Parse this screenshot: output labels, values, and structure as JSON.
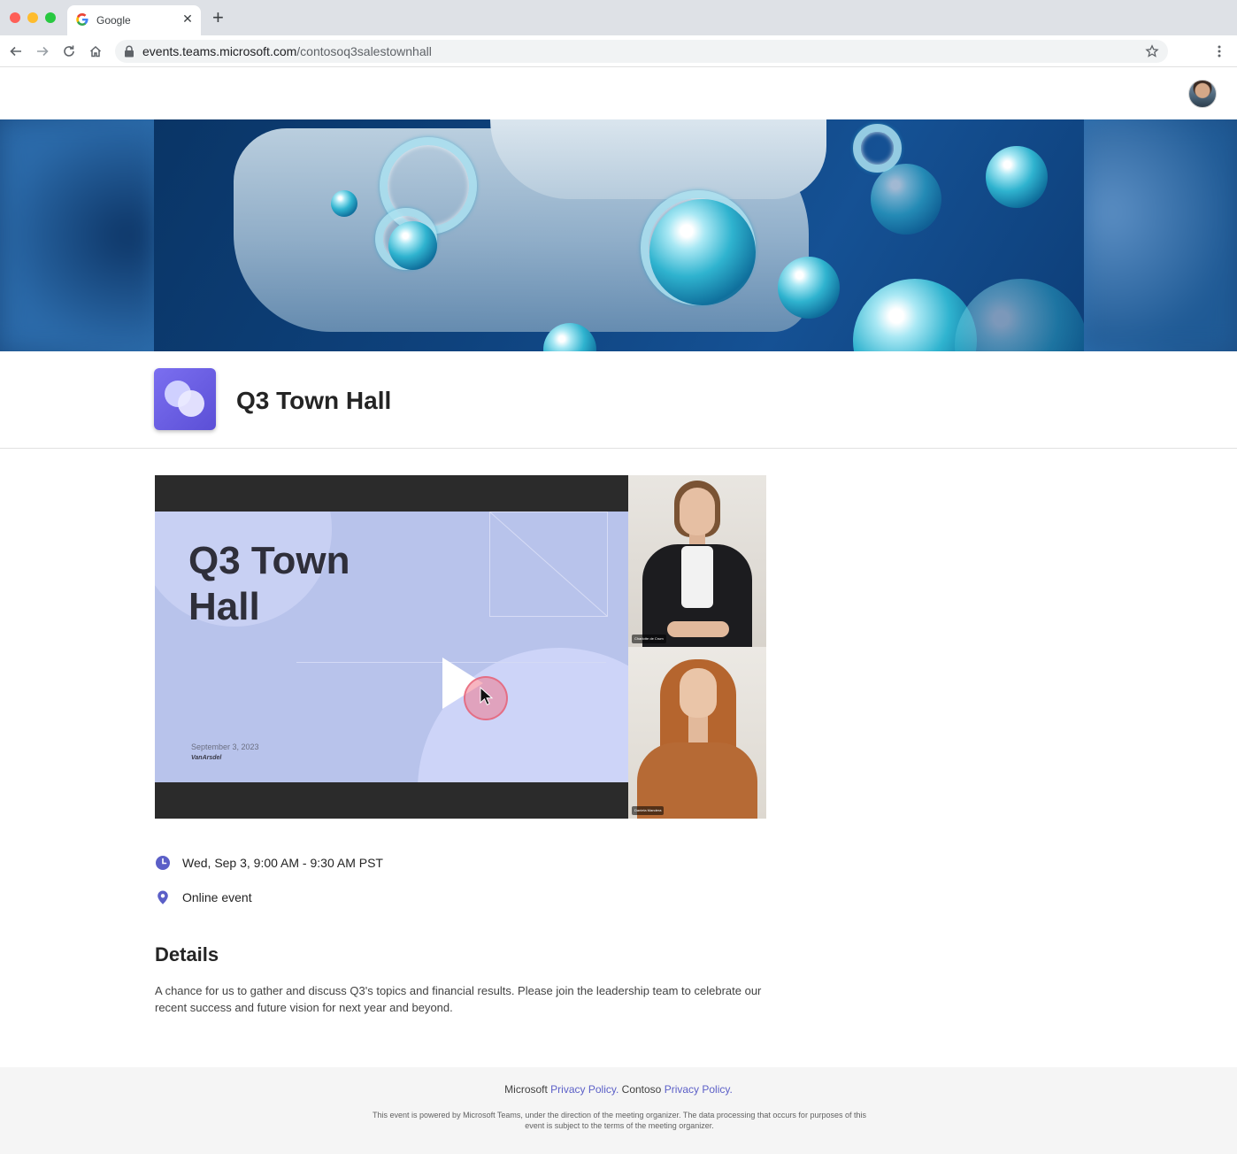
{
  "browser": {
    "tab_title": "Google",
    "tab_close": "✕",
    "new_tab": "+",
    "url_host": "events.teams.microsoft.com",
    "url_path": "/contosoq3salestownhall"
  },
  "event": {
    "title": "Q3 Town Hall",
    "video": {
      "slide_title": "Q3 Town Hall",
      "slide_date": "September 3, 2023",
      "slide_logo": "VanArsdel",
      "presenter_1": "Charlotte de Crum",
      "presenter_2": "Daniela Mandera"
    },
    "datetime": "Wed, Sep 3, 9:00 AM - 9:30 AM PST",
    "location": "Online event",
    "details_heading": "Details",
    "details_body": "A chance for us to gather and discuss Q3's topics and financial results. Please join the leadership team to celebrate our recent success and future vision for next year and beyond."
  },
  "footer": {
    "ms_prefix": "Microsoft ",
    "ms_link": "Privacy Policy.",
    "contoso_prefix": " Contoso ",
    "contoso_link": "Privacy Policy.",
    "note": "This event is powered by Microsoft Teams, under the direction of the meeting organizer. The data processing that occurs for purposes of this event is subject to the terms of the meeting organizer."
  },
  "colors": {
    "accent": "#5b5fc7",
    "event_icon": "#6b5fe3"
  },
  "icons": {
    "back": "arrow-left-icon",
    "forward": "arrow-right-icon",
    "reload": "reload-icon",
    "home": "home-icon",
    "lock": "lock-icon",
    "bookmark": "star-icon",
    "menu": "kebab-menu-icon",
    "time": "clock-icon",
    "location": "location-pin-icon",
    "play": "play-icon"
  }
}
